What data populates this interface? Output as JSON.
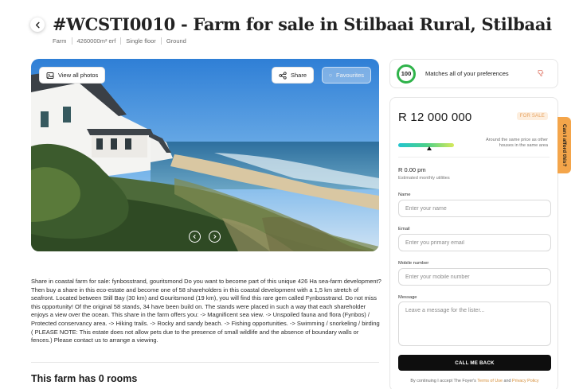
{
  "header": {
    "title": "#WCSTI0010 - Farm for sale in Stilbaai Rural, Stilbaai",
    "meta": [
      "Farm",
      "4260000m² erf",
      "Single floor",
      "Ground"
    ]
  },
  "gallery": {
    "view_all_label": "View all photos",
    "share_label": "Share",
    "favourites_label": "Favourites"
  },
  "description": "Share in coastal farm for sale: fynbosstrand, gouritsmond Do you want to become part of this unique 426 Ha sea-farm development? Then buy a share in this eco-estate and become one of 58 shareholders in this coastal development with a 1,5 km stretch of seafront. Located between Still Bay (30 km) and Gouritsmond (19 km), you will find this rare gem called Fynbosstrand. Do not miss this opportunity! Of the original 58 stands, 34 have been build on. The stands were placed in such a way that each shareholder enjoys a view over the ocean. This share in the farm offers you: -> Magnificent sea view. -> Unspoiled fauna and flora (Fynbos) / Protected conservancy area. -> Hiking trails. -> Rocky and sandy beach. -> Fishing opportunities. -> Swimming / snorkeling / birding ( PLEASE NOTE: This estate does not allow pets due to the presence of small wildlife and the absence of boundary walls or fences.) Please contact us to arrange a viewing.",
  "rooms_title": "This farm has 0 rooms",
  "match": {
    "score": "100",
    "text": "Matches all of your preferences",
    "ring_color": "#2fb34a"
  },
  "listing": {
    "price": "R 12 000 000",
    "status": "FOR SALE",
    "price_comparison": "Around the same price as other houses in the same area",
    "utilities_value": "R 0.00 pm",
    "utilities_label": "Estimated monthly utilities"
  },
  "form": {
    "name_label": "Name",
    "name_placeholder": "Enter your name",
    "email_label": "Email",
    "email_placeholder": "Enter you primary email",
    "mobile_label": "Mobile number",
    "mobile_placeholder": "Enter your mobile number",
    "message_label": "Message",
    "message_placeholder": "Leave a message for the lister...",
    "submit_label": "CALL ME BACK",
    "terms_prefix": "By continuing I accept The Foyer's",
    "terms_link": "Terms of Use",
    "terms_and": "and",
    "privacy_link": "Privacy Policy"
  },
  "afford_tab_label": "Can I afford this?",
  "colors": {
    "accent": "#f4a54a",
    "button": "#0e0e0e",
    "link": "#d58c35"
  },
  "icons": [
    "back-arrow-icon",
    "gallery-icon",
    "share-icon",
    "heart-icon",
    "thumbs-down-icon",
    "chevron-left-icon",
    "chevron-right-icon"
  ]
}
